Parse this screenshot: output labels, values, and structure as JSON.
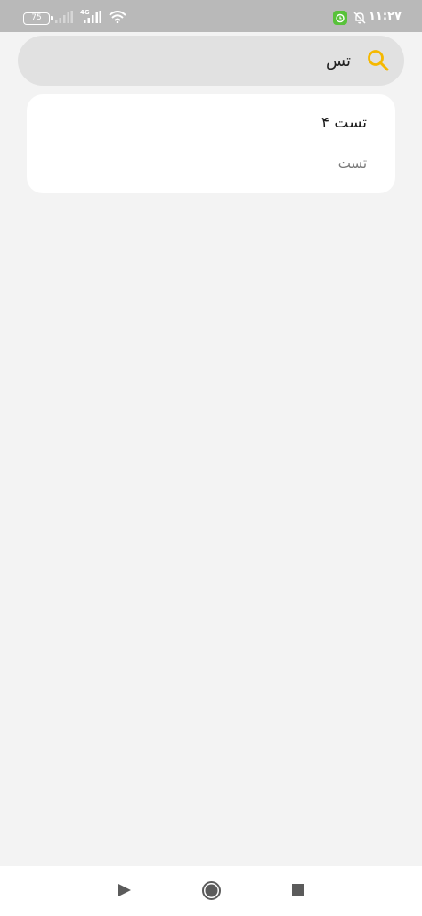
{
  "status_bar": {
    "battery_level": "75",
    "network_type": "4G",
    "time": "۱۱:۲۷",
    "icons": [
      "signal-icon",
      "signal-icon",
      "wifi-icon",
      "alarm-icon",
      "bell-off-icon"
    ],
    "alarm_badge_color": "#58c23a"
  },
  "search": {
    "value": "تس",
    "icon": "search-icon",
    "accent_color": "#f5b800"
  },
  "results": [
    {
      "title": "تست ۴",
      "subtitle": "تست"
    }
  ],
  "nav_bar": {
    "icons": [
      "back-triangle-icon",
      "home-circle-icon",
      "recents-square-icon"
    ]
  }
}
